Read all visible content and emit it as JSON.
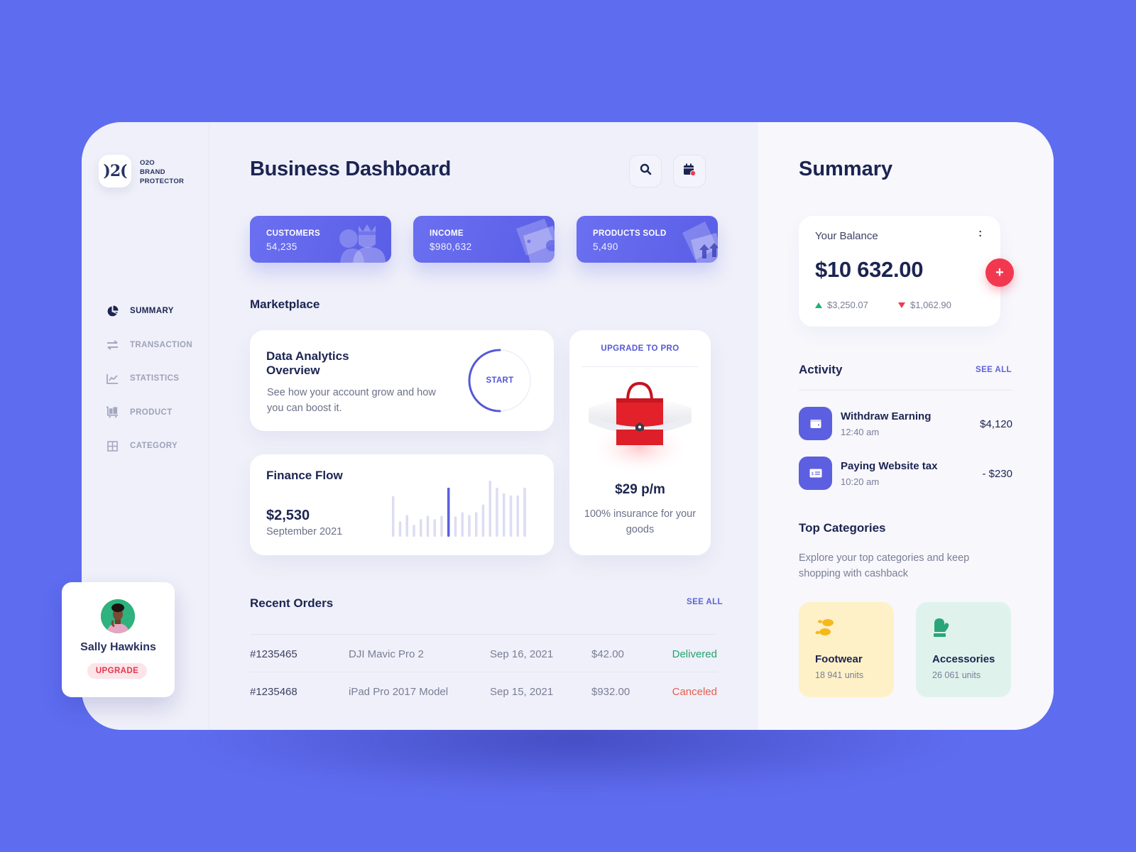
{
  "brand": {
    "logo_mark": ")2(",
    "line1": "O2O",
    "line2": "BRAND",
    "line3": "PROTECTOR"
  },
  "sidebar": {
    "items": [
      {
        "label": "SUMMARY",
        "icon": "pie-chart-icon",
        "active": true
      },
      {
        "label": "TRANSACTION",
        "icon": "transfer-arrows-icon",
        "active": false
      },
      {
        "label": "STATISTICS",
        "icon": "line-chart-icon",
        "active": false
      },
      {
        "label": "PRODUCT",
        "icon": "cart-icon",
        "active": false
      },
      {
        "label": "CATEGORY",
        "icon": "grid-icon",
        "active": false
      }
    ]
  },
  "profile": {
    "name": "Sally Hawkins",
    "upgrade_label": "UPGRADE"
  },
  "header": {
    "title": "Business Dashboard",
    "search_icon": "search-icon",
    "calendar_icon": "calendar-icon"
  },
  "stats": [
    {
      "label": "CUSTOMERS",
      "value": "54,235",
      "icon": "users-crown-icon"
    },
    {
      "label": "INCOME",
      "value": "$980,632",
      "icon": "banknotes-icon"
    },
    {
      "label": "PRODUCTS SOLD",
      "value": "5,490",
      "icon": "boxes-arrow-up-icon"
    }
  ],
  "marketplace": {
    "title": "Marketplace",
    "analytics": {
      "title_line1": "Data Analytics",
      "title_line2": "Overview",
      "description": "See how your account grow and how you can boost it.",
      "start_label": "START"
    },
    "finance": {
      "title": "Finance Flow",
      "amount": "$2,530",
      "period": "September 2021"
    },
    "pro": {
      "header": "UPGRADE TO PRO",
      "price": "$29 p/m",
      "description": "100% insurance for your goods"
    }
  },
  "chart_data": {
    "type": "bar",
    "title": "Finance Flow",
    "values": [
      58,
      22,
      31,
      17,
      25,
      30,
      25,
      30,
      70,
      29,
      35,
      31,
      35,
      46,
      80,
      70,
      62,
      59,
      59,
      70
    ],
    "highlight_index": 8,
    "ylim": [
      0,
      85
    ],
    "colors": {
      "bar": "#dcdcf3",
      "highlight": "#5c5fdf"
    }
  },
  "orders": {
    "title": "Recent Orders",
    "see_all": "SEE ALL",
    "rows": [
      {
        "id": "#1235465",
        "name": "DJI Mavic Pro 2",
        "date": "Sep 16, 2021",
        "amount": "$42.00",
        "status": "Delivered",
        "status_color": "#22a370"
      },
      {
        "id": "#1235468",
        "name": "iPad Pro 2017 Model",
        "date": "Sep 15, 2021",
        "amount": "$932.00",
        "status": "Canceled",
        "status_color": "#ec5a4f"
      }
    ]
  },
  "summary": {
    "title": "Summary",
    "balance": {
      "label": "Your Balance",
      "menu": ":",
      "amount": "$10 632.00",
      "income": "$3,250.07",
      "expense": "$1,062.90",
      "add_label": "+"
    },
    "activity": {
      "title": "Activity",
      "see_all": "SEE ALL",
      "items": [
        {
          "name": "Withdraw Earning",
          "time": "12:40 am",
          "amount": "$4,120",
          "icon": "wallet-icon"
        },
        {
          "name": "Paying Website tax",
          "time": "10:20 am",
          "amount": "- $230",
          "icon": "bill-icon"
        }
      ]
    },
    "categories": {
      "title": "Top Categories",
      "description": "Explore your top categories and keep shopping with cashback",
      "items": [
        {
          "name": "Footwear",
          "units": "18 941 units",
          "icon": "footprints-icon",
          "bg": "#fff1c7",
          "icon_color": "#f6b81c"
        },
        {
          "name": "Accessories",
          "units": "26 061 units",
          "icon": "mitten-icon",
          "bg": "#dff3ec",
          "icon_color": "#2aa57a"
        }
      ]
    }
  },
  "colors": {
    "background": "#5e6cef",
    "accent": "#5c5fdf",
    "danger": "#f2384f",
    "text_dark": "#1c2451"
  }
}
